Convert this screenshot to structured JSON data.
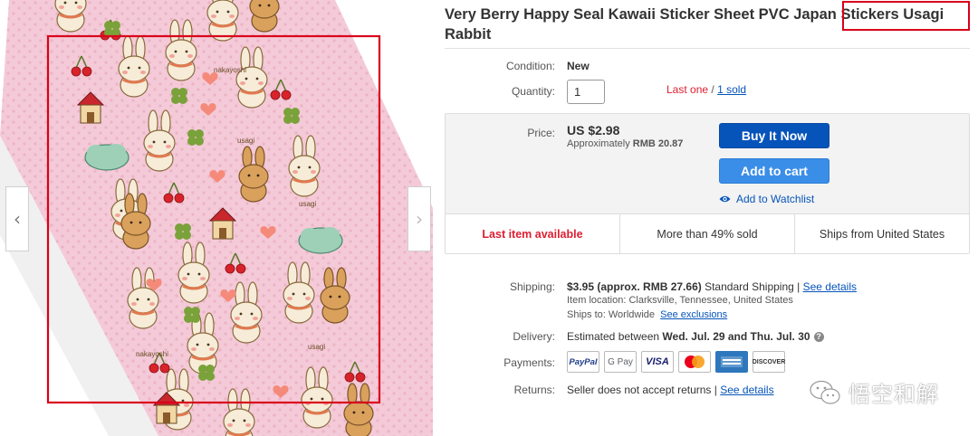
{
  "listing": {
    "title": "Very Berry Happy Seal Kawaii Sticker Sheet PVC Japan Stickers Usagi Rabbit"
  },
  "image": {
    "prev_arrow": "‹",
    "next_arrow": "›",
    "sticker_words": [
      "usagi",
      "nakayoshi",
      "usagi",
      "usagi",
      "nakayoshi"
    ]
  },
  "condition": {
    "label": "Condition:",
    "value": "New"
  },
  "quantity": {
    "label": "Quantity:",
    "value": "1",
    "last_one": "Last one",
    "separator": " / ",
    "sold_link": "1 sold"
  },
  "price": {
    "label": "Price:",
    "value": "US $2.98",
    "approx_prefix": "Approximately ",
    "approx_value": "RMB 20.87"
  },
  "buttons": {
    "buy_now": "Buy It Now",
    "add_to_cart": "Add to cart",
    "watchlist": "Add to Watchlist"
  },
  "highlights": [
    "Last item available",
    "More than 49% sold",
    "Ships from United States"
  ],
  "shipping": {
    "label": "Shipping:",
    "cost": "$3.95",
    "approx": "(approx. RMB 27.66)",
    "method": "Standard Shipping",
    "divider": " | ",
    "details_link": "See details",
    "location_line": "Item location:  Clarksville, Tennessee, United States",
    "ships_to_line": "Ships to:  Worldwide",
    "exclusions_link": "See exclusions"
  },
  "delivery": {
    "label": "Delivery:",
    "prefix": "Estimated between ",
    "dates": "Wed. Jul. 29 and Thu. Jul. 30",
    "info": "?"
  },
  "payments": {
    "label": "Payments:",
    "methods": [
      "PayPal",
      "G Pay",
      "VISA",
      "MasterCard",
      "American Express",
      "DISCOVER"
    ]
  },
  "returns": {
    "label": "Returns:",
    "value": "Seller does not accept returns",
    "divider": " | ",
    "details_link": "See details"
  },
  "watermark": {
    "text": "悟空和解"
  },
  "colors": {
    "link": "#0654ba",
    "buy_button": "#0654ba",
    "cart_button": "#3b8ee8",
    "alert_red": "#dd1e31",
    "annotation_red": "#d9001b",
    "sticker_pink": "#f2c6d4"
  }
}
